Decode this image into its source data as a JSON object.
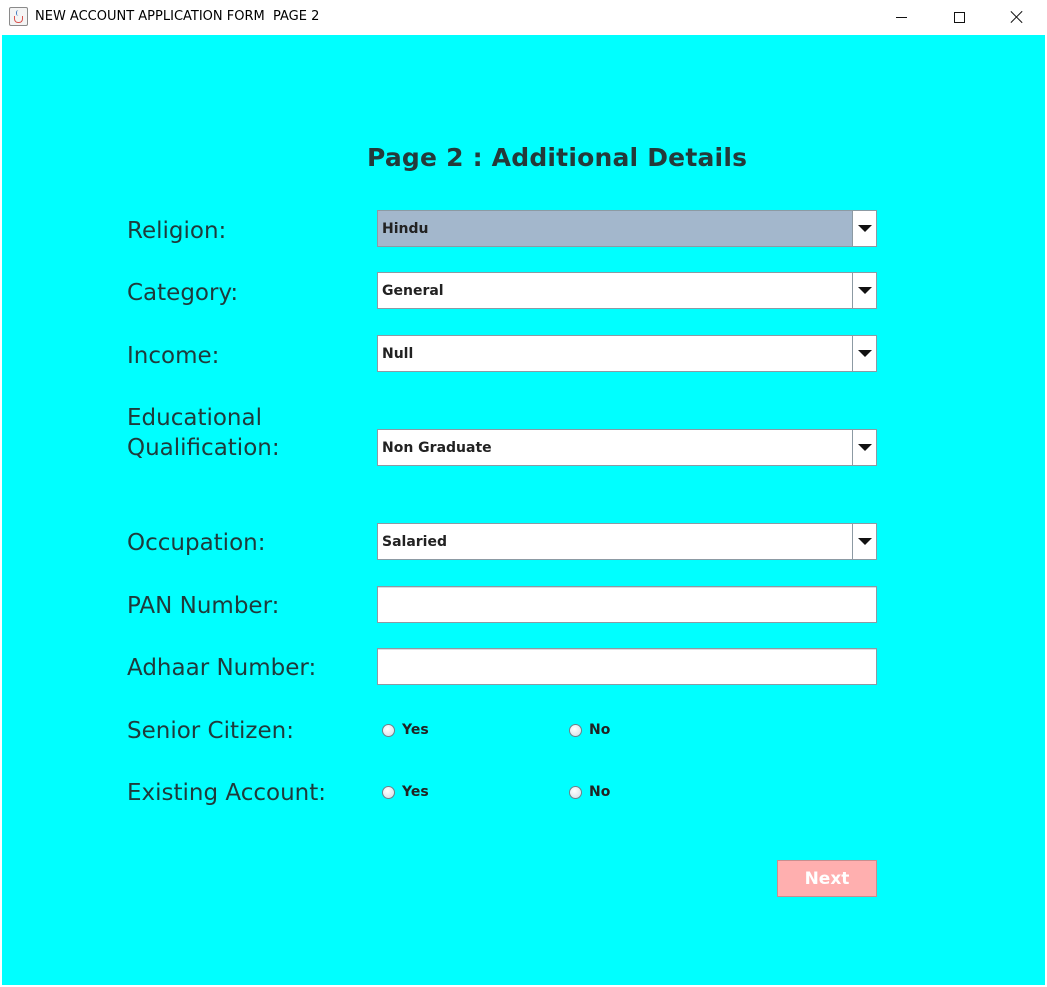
{
  "window": {
    "title": "NEW ACCOUNT APPLICATION FORM  PAGE 2",
    "app_icon": "java-cup-icon",
    "controls": [
      "minimize-icon",
      "maximize-icon",
      "close-icon"
    ]
  },
  "form": {
    "heading": "Page 2 : Additional Details",
    "religion": {
      "label": "Religion:",
      "value": "Hindu"
    },
    "category": {
      "label": "Category:",
      "value": "General"
    },
    "income": {
      "label": "Income:",
      "value": "Null"
    },
    "education": {
      "label_line1": "Educational",
      "label_line2": "Qualification:",
      "value": "Non Graduate"
    },
    "occupation": {
      "label": "Occupation:",
      "value": "Salaried"
    },
    "pan": {
      "label": "PAN Number:",
      "value": ""
    },
    "adhaar": {
      "label": "Adhaar Number:",
      "value": ""
    },
    "senior_citizen": {
      "label": "Senior Citizen:",
      "yes": "Yes",
      "no": "No"
    },
    "existing_account": {
      "label": "Existing Account:",
      "yes": "Yes",
      "no": "No"
    },
    "next_label": "Next"
  },
  "colors": {
    "panel_background": "#00ffff",
    "selected_combo": "#a3b7cc",
    "next_button": "#ffafaf"
  }
}
